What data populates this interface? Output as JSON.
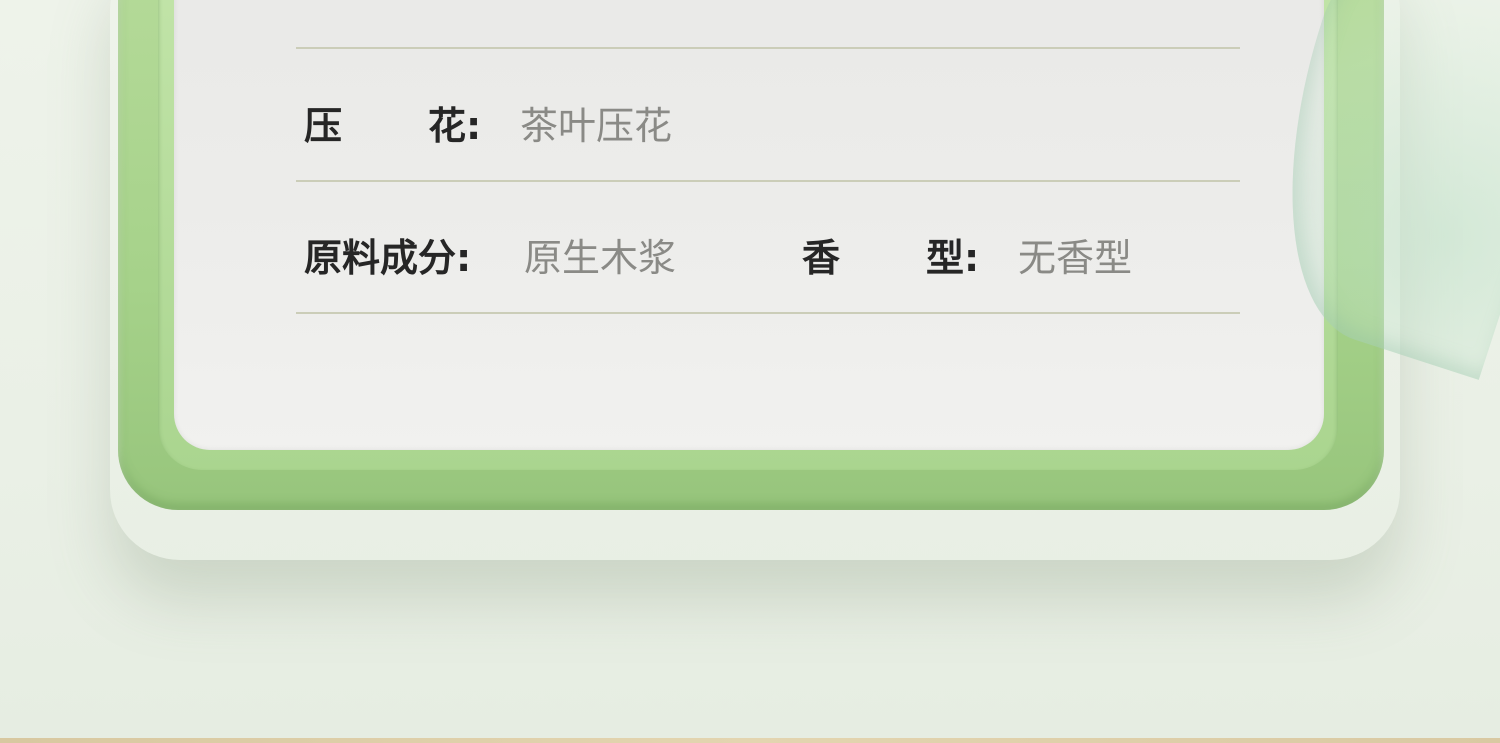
{
  "spec_rows": [
    {
      "label_left": "压",
      "label_right": "花:",
      "value": "茶叶压花"
    },
    {
      "label": "原料成分:",
      "value": "原生木浆",
      "label2_left": "香",
      "label2_right": "型:",
      "value2": "无香型"
    }
  ],
  "colors": {
    "frame_green": "#a6d28a",
    "panel": "#ececea",
    "label_text": "#262626",
    "value_text": "#8a8a86",
    "rule": "#cbcdb8"
  }
}
